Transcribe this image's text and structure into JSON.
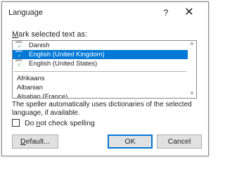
{
  "dialog": {
    "title": "Language",
    "help_symbol": "?",
    "close_symbol": "✕",
    "mark_label_prefix": "",
    "mark_label_accel": "M",
    "mark_label_rest": "ark selected text as:",
    "languages_proofing": [
      "Danish",
      "English (United Kingdom)",
      "English (United States)"
    ],
    "languages_other": [
      "Afrikaans",
      "Albanian",
      "Alsatian (France)"
    ],
    "selected_language": "English (United Kingdom)",
    "info_text": "The speller automatically uses dictionaries of the selected language, if available.",
    "checkbox": {
      "checked": false,
      "label_pre": "Do ",
      "label_accel": "n",
      "label_post": "ot check spelling"
    },
    "buttons": {
      "default_accel": "D",
      "default_rest": "efault...",
      "ok": "OK",
      "cancel": "Cancel"
    },
    "scroll_up_symbol": "˄",
    "scroll_down_symbol": "˅",
    "proof_icon_text": "abc",
    "proof_icon_check": "✓"
  },
  "colors": {
    "accent": "#0078d7",
    "button_face": "#e1e1e1"
  }
}
